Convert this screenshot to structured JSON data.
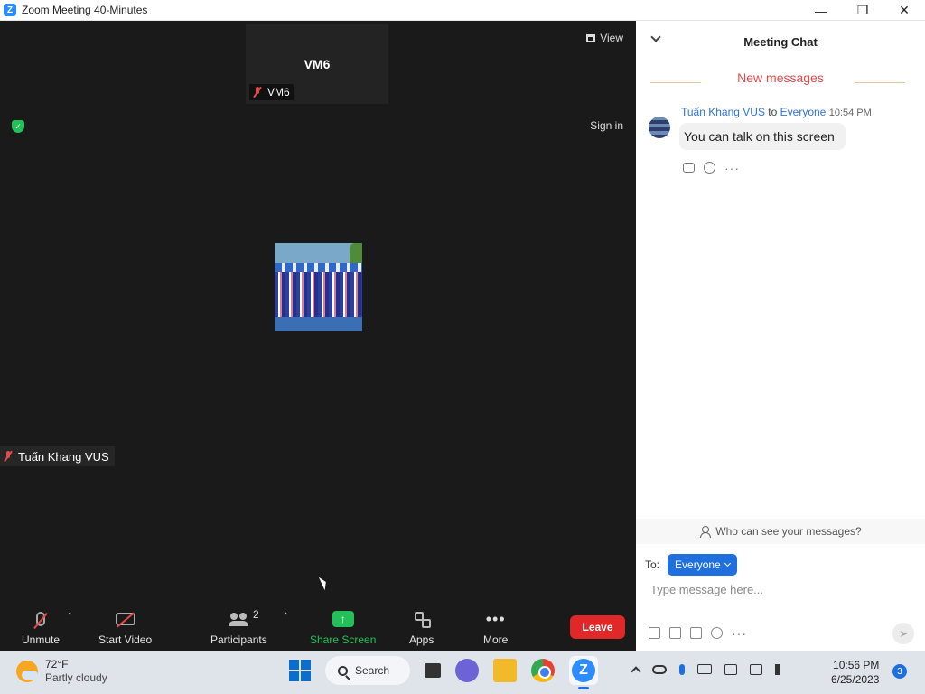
{
  "window": {
    "title": "Zoom Meeting 40-Minutes",
    "controls": {
      "minimize": "—",
      "maximize": "❐",
      "close": "✕"
    }
  },
  "video": {
    "view_label": "View",
    "signin_label": "Sign in",
    "participants": [
      {
        "display_name": "VM6",
        "label": "VM6",
        "muted": true
      },
      {
        "label": "Tuấn Khang VUS",
        "muted": true
      }
    ]
  },
  "toolbar": {
    "unmute_label": "Unmute",
    "start_video_label": "Start Video",
    "participants_label": "Participants",
    "participants_count": "2",
    "share_screen_label": "Share Screen",
    "share_icon": "↑",
    "apps_label": "Apps",
    "more_label": "More",
    "more_icon": "•••",
    "leave_label": "Leave",
    "caret": "⌃"
  },
  "chat": {
    "title": "Meeting Chat",
    "new_messages_label": "New messages",
    "messages": [
      {
        "sender": "Tuấn Khang VUS",
        "to_word": "to",
        "recipient": "Everyone",
        "time": "10:54 PM",
        "text": "You can talk on this screen"
      }
    ],
    "more_dots": "···",
    "who_can_see_label": "Who can see your messages?",
    "to_label": "To:",
    "recipient_selector": "Everyone",
    "input_placeholder": "Type message here...",
    "send_icon": "➤"
  },
  "taskbar": {
    "weather_temp": "72°F",
    "weather_desc": "Partly cloudy",
    "search_label": "Search",
    "zoom_letter": "Z",
    "clock_time": "10:56 PM",
    "clock_date": "6/25/2023",
    "notification_count": "3"
  },
  "colors": {
    "accent": "#2d8cff",
    "leave": "#e02828",
    "share": "#23c05a",
    "new_messages": "#e04a4a",
    "link": "#2f73d9"
  }
}
